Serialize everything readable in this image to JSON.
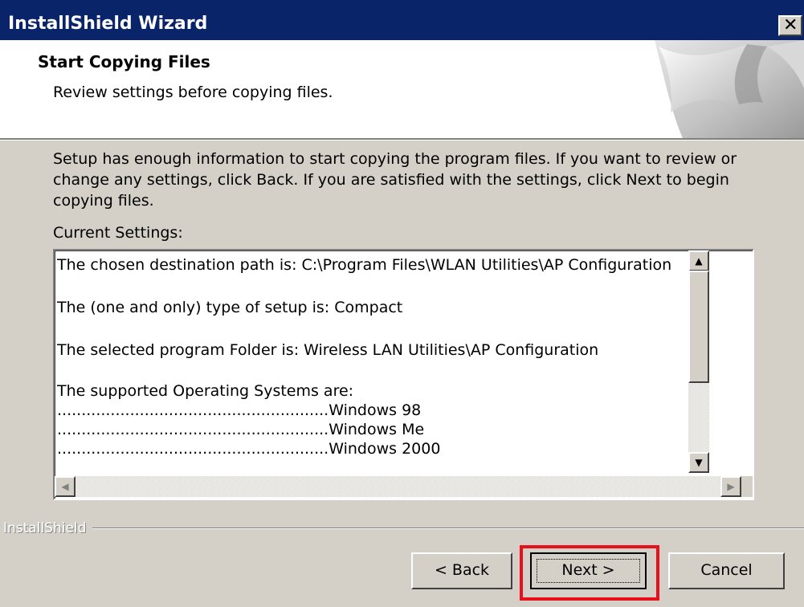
{
  "window": {
    "title": "InstallShield Wizard",
    "close_glyph": "✕"
  },
  "header": {
    "title": "Start Copying Files",
    "subtitle": "Review settings before copying files."
  },
  "body": {
    "lines": [
      "Setup has enough information to start copying the program files.  If you want to review or",
      "change any settings, click Back.  If you are satisfied with the settings, click Next to begin",
      "copying files."
    ],
    "current_settings_label": "Current Settings:"
  },
  "settings_list": {
    "lines": [
      "The chosen destination path is: C:\\Program Files\\WLAN Utilities\\AP Configuration",
      "The (one and only) type of setup is: Compact",
      "The selected program Folder is: Wireless LAN Utilities\\AP Configuration",
      "The supported Operating Systems are:",
      "........................................................Windows 98",
      "........................................................Windows Me",
      "........................................................Windows 2000"
    ]
  },
  "footer": {
    "brand": "InstallShield",
    "back_label": "< Back",
    "next_label": "Next >",
    "cancel_label": "Cancel"
  },
  "colors": {
    "titlebar": "#0a246a",
    "face": "#d4d0c8",
    "highlight_box": "#e8101a"
  }
}
